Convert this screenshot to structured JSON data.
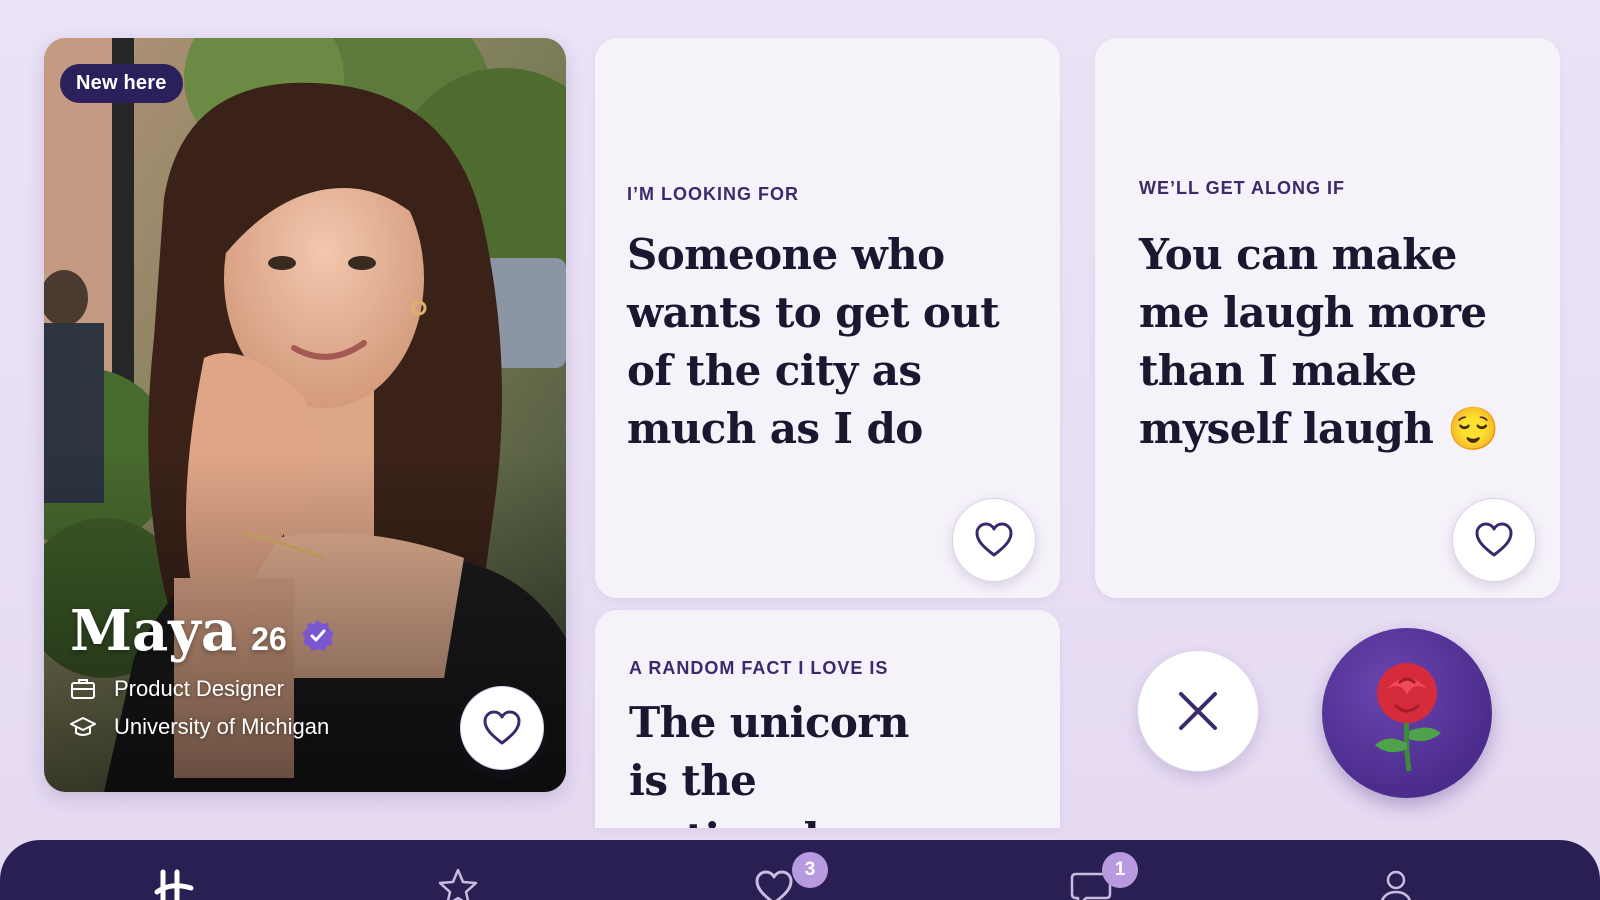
{
  "profile": {
    "badge": "New here",
    "name": "Maya",
    "age": "26",
    "job": "Product Designer",
    "school": "University of Michigan"
  },
  "prompts": [
    {
      "label": "I’M LOOKING FOR",
      "answer": "Someone who wants to get out of the city as much as I do"
    },
    {
      "label": "WE’LL GET ALONG IF",
      "answer": "You can make me laugh more than I make myself laugh 😌"
    },
    {
      "label": "A RANDOM FACT I LOVE IS",
      "answer": "The unicorn is the national"
    }
  ],
  "nav": {
    "likes_badge": "3",
    "messages_badge": "1"
  },
  "colors": {
    "accent": "#2a1f52",
    "brand_purple": "#4b2c8c",
    "badge_lavender": "#b89ae0",
    "background": "#ebe3f6"
  },
  "icons": {
    "like": "heart-icon",
    "skip": "close-icon",
    "rose": "rose-icon",
    "verified": "verified-badge-icon",
    "job": "briefcase-icon",
    "school": "graduation-cap-icon",
    "home": "hinge-logo-icon",
    "standouts": "star-icon",
    "likes": "heart-icon",
    "messages": "chat-bubble-icon",
    "profile": "person-icon"
  }
}
